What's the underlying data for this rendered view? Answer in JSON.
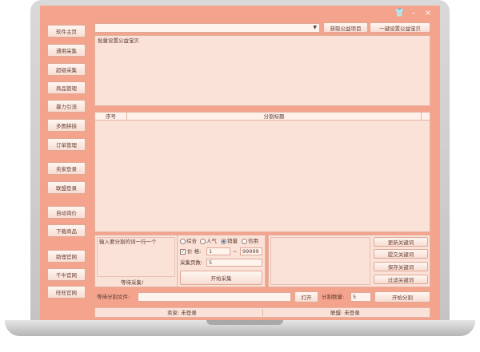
{
  "window": {
    "skin_icon": "shirt-icon",
    "minimize_icon": "minimize-icon",
    "close_icon": "close-icon"
  },
  "sidebar": {
    "items": [
      {
        "label": "软件主页"
      },
      {
        "label": "通用采集"
      },
      {
        "label": "超级采集"
      },
      {
        "label": "商品管理"
      },
      {
        "label": "暴力引流"
      },
      {
        "label": "多图拼接"
      },
      {
        "label": "订单管理"
      },
      {
        "label": "卖家登录"
      },
      {
        "label": "联盟登录"
      },
      {
        "label": "自动询价"
      },
      {
        "label": "下载商品"
      },
      {
        "label": "助理官网"
      },
      {
        "label": "千牛官网"
      },
      {
        "label": "旺旺官网"
      }
    ]
  },
  "top": {
    "get_project_label": "获取公益项目",
    "one_click_label": "一键设置公益宝贝",
    "batch_text": "批量设置公益宝贝"
  },
  "table": {
    "columns": [
      "序号",
      "分割标题"
    ]
  },
  "split": {
    "textarea_placeholder": "输入要分割的词一行一个",
    "waiting_label": "等待采集!",
    "sort_options": [
      "综合",
      "人气",
      "销量",
      "信用"
    ],
    "sort_selected": "销量",
    "price_checked": true,
    "price_label": "价 格:",
    "price_min": "1",
    "price_sep": "~",
    "price_max": "99999",
    "pages_label": "采集页数:",
    "pages_value": "5",
    "start_collect_label": "开始采集"
  },
  "keyword_buttons": [
    "更新关键词",
    "提交关键词",
    "保存关键词",
    "过滤关键词"
  ],
  "file_row": {
    "label": "等待分割文件:",
    "open_label": "打开",
    "count_label": "分割数量:",
    "count_value": "5",
    "start_split_label": "开始分割"
  },
  "status": {
    "seller": "卖家: 未登录",
    "alliance": "联盟: 未登录"
  }
}
